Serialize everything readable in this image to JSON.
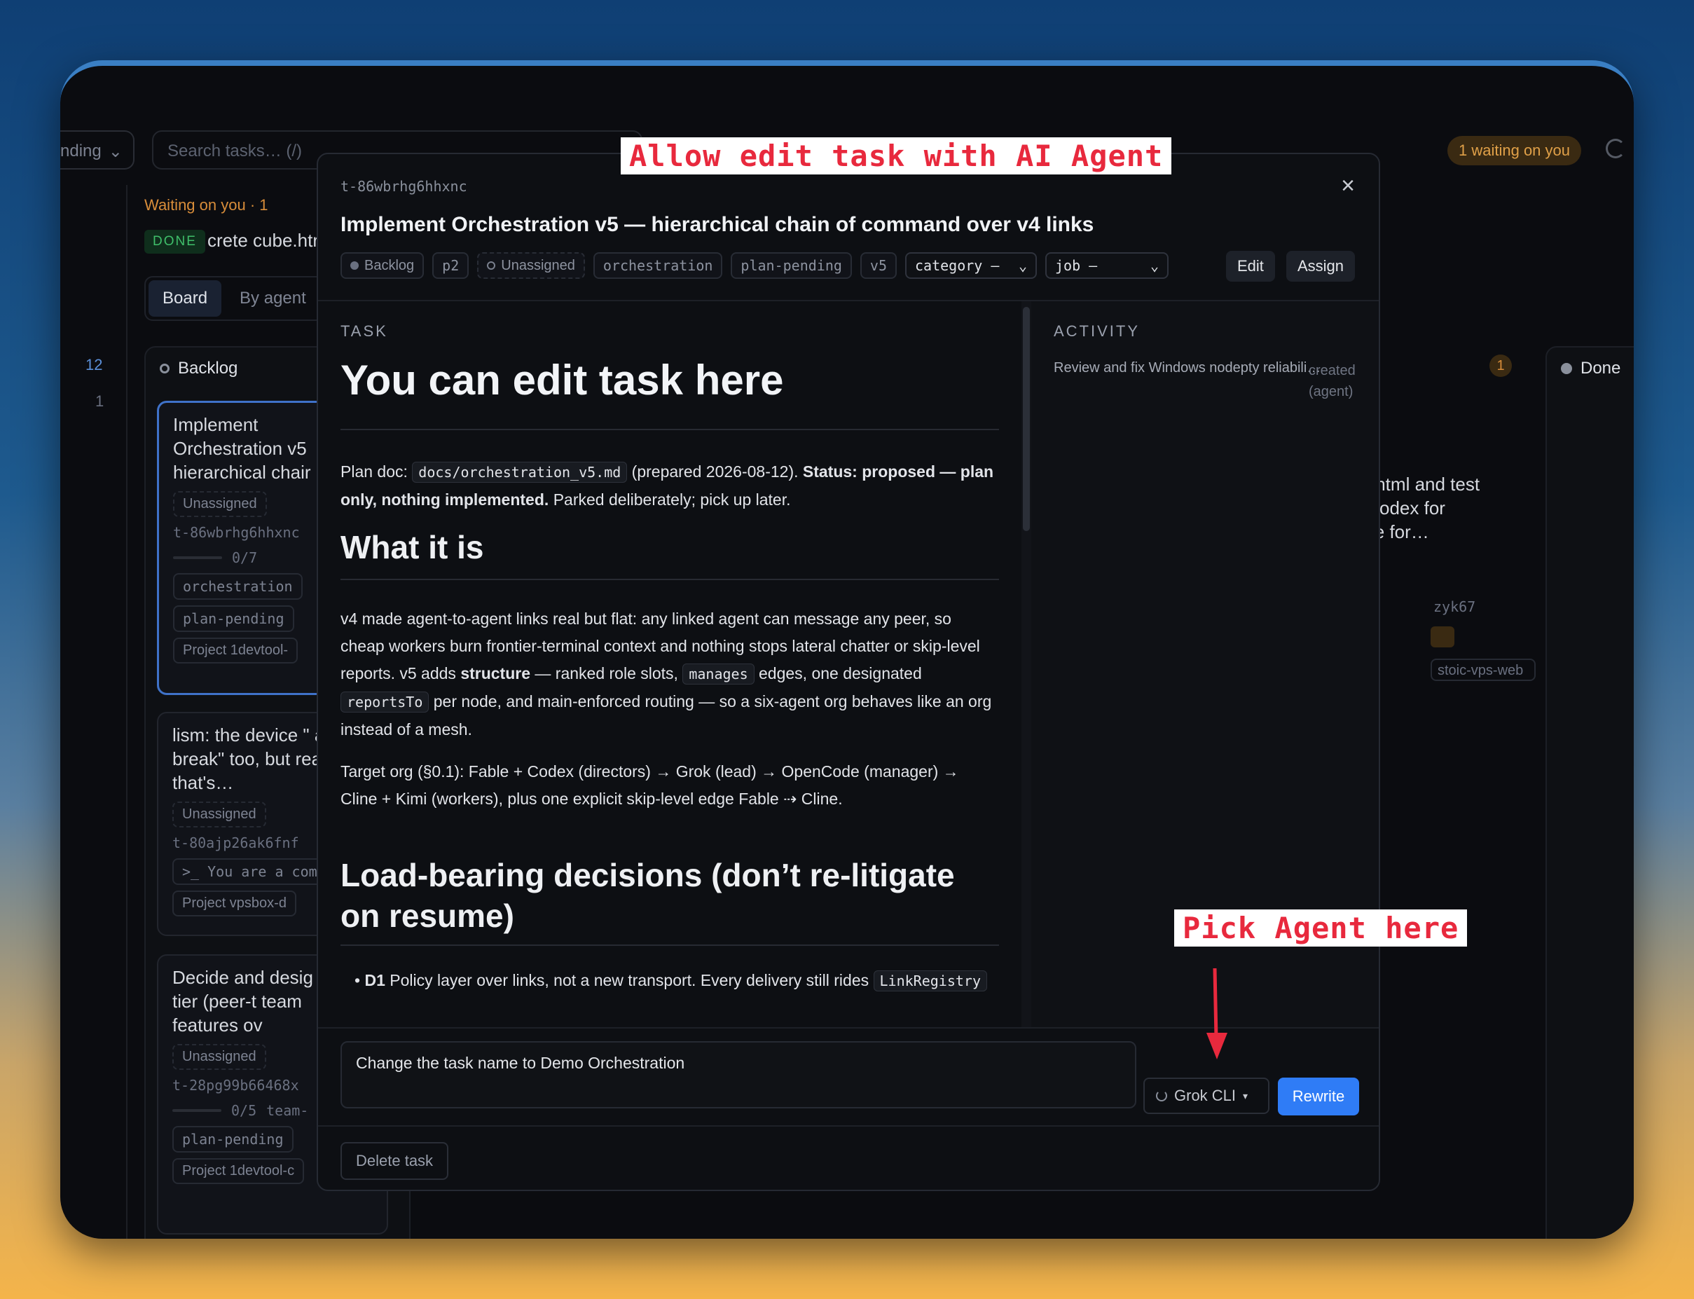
{
  "background_app": {
    "pending_label": "nding",
    "search_placeholder": "Search tasks… (/)",
    "waiting_pill": "1 waiting on you",
    "rail_counts": [
      "12",
      "1"
    ],
    "waiting_title": "Waiting on you · 1",
    "done_badge": "DONE",
    "waiting_task": "crete cube.htr",
    "tabs": [
      "Board",
      "By agent"
    ],
    "backlog_label": "Backlog",
    "done_label": "Done",
    "right_count": "1",
    "cards": [
      {
        "title": "Implement Orchestration v5 hierarchical chair",
        "assignee": "Unassigned",
        "id": "t-86wbrhg6hhxnc",
        "progress": "0/7",
        "tags": [
          "orchestration",
          "plan-pending"
        ],
        "project": "Project 1devtool-"
      },
      {
        "title": "lism: the device \" a break\" too, but reason that's…",
        "assignee": "Unassigned",
        "id": "t-80ajp26ak6fnf",
        "cmd": ">_ You are a come",
        "project": "Project vpsbox-d"
      },
      {
        "title": "Decide and desig Team tier (peer-t team features ov",
        "assignee": "Unassigned",
        "id": "t-28pg99b66468x",
        "progress": "0/5",
        "tags": [
          "team-",
          "plan-pending"
        ],
        "project": "Project 1devtool-c"
      }
    ],
    "right_card": {
      "text_lines": [
        ".html and test",
        "codex for",
        "le for…"
      ],
      "id": "zyk67",
      "project": "stoic-vps-web"
    }
  },
  "modal": {
    "task_id": "t-86wbrhg6hhxnc",
    "title": "Implement Orchestration v5 — hierarchical chain of command over v4 links",
    "tags": {
      "status": "Backlog",
      "priority": "p2",
      "assignee": "Unassigned",
      "labels": [
        "orchestration",
        "plan-pending",
        "v5"
      ]
    },
    "category_select": "category —",
    "job_select": "job —",
    "edit_label": "Edit",
    "assign_label": "Assign",
    "task_section": "TASK",
    "heading": "You can edit task here",
    "plan_doc_prefix": "Plan doc:",
    "plan_doc_path": "docs/orchestration_v5.md",
    "plan_doc_date": "(prepared 2026-08-12).",
    "status_bold": "Status: proposed — plan only, nothing implemented.",
    "plan_doc_tail": "Parked deliberately; pick up later.",
    "h_what": "What it is",
    "what_p1_a": "v4 made agent-to-agent links real but flat: any linked agent can message any peer, so cheap workers burn frontier-terminal context and nothing stops lateral chatter or skip-level reports. v5 adds",
    "what_p1_bold": "structure",
    "what_p1_b": "— ranked role slots,",
    "what_code1": "manages",
    "what_p1_c": "edges, one designated",
    "what_code2": "reportsTo",
    "what_p1_d": "per node, and main-enforced routing — so a six-agent org behaves like an org instead of a mesh.",
    "what_p2": "Target org (§0.1): Fable + Codex (directors) → Grok (lead) → OpenCode (manager) → Cline + Kimi (workers), plus one explicit skip-level edge Fable ⇢ Cline.",
    "h_load": "Load-bearing decisions (don’t re-litigate on resume)",
    "d1_bold": "D1",
    "d1_text": "Policy layer over links, not a new transport. Every delivery still rides",
    "d1_code": "LinkRegistry",
    "activity_section": "ACTIVITY",
    "activity_item": "Review and fix Windows nodepty reliabili…",
    "activity_meta": "created (agent)",
    "prompt_value": "Change the task name to Demo Orchestration",
    "agent_label": "Grok CLI",
    "rewrite_label": "Rewrite",
    "delete_label": "Delete task"
  },
  "annotations": {
    "top": "Allow edit task with AI Agent",
    "pick": "Pick Agent here"
  },
  "colors": {
    "accent": "#2f7cf6",
    "annotation": "#e8293d",
    "waiting": "#d88d3a"
  }
}
